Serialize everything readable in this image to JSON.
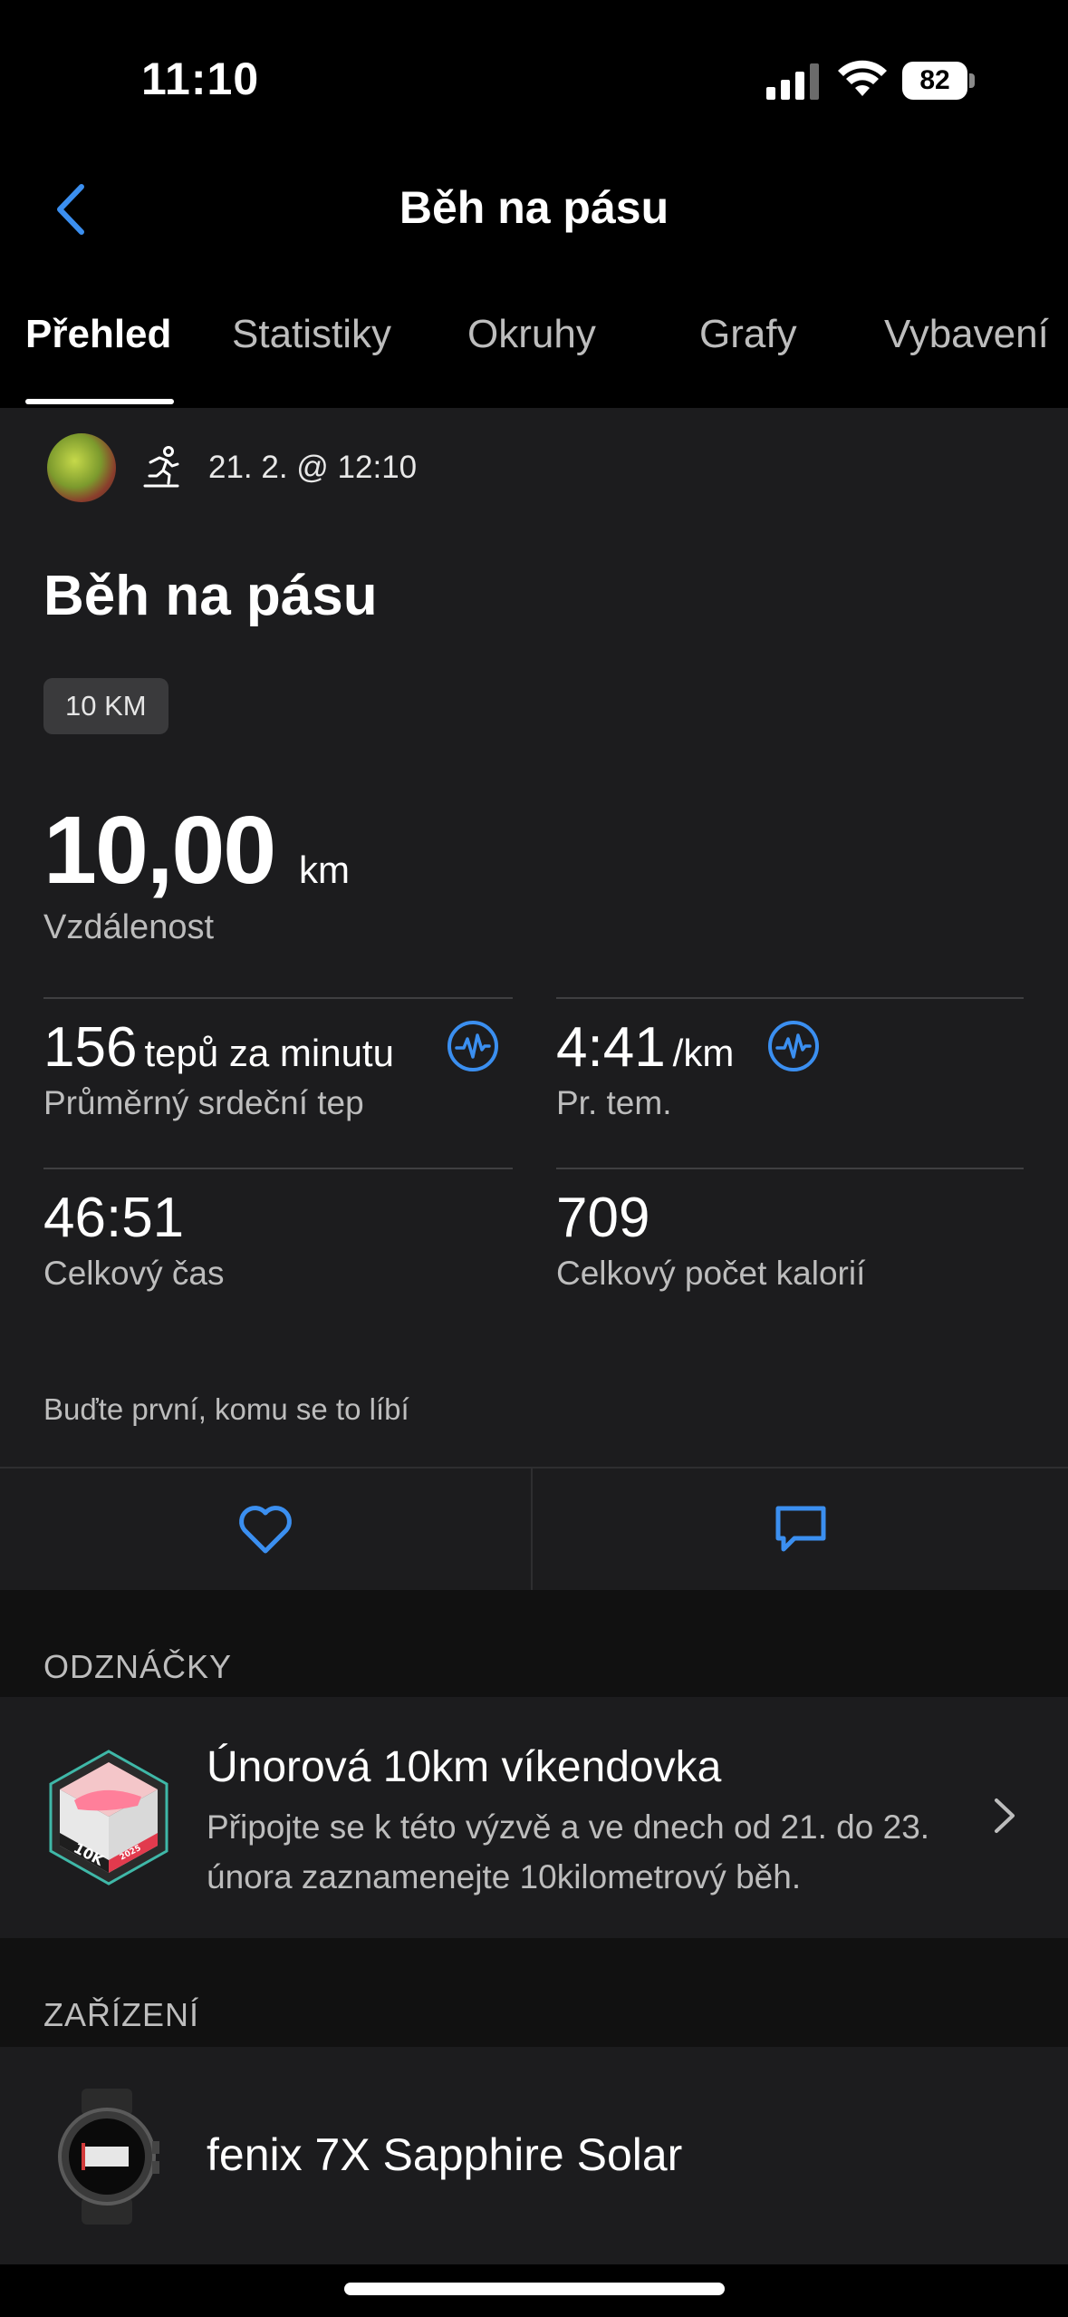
{
  "status_bar": {
    "time": "11:10",
    "battery": "82"
  },
  "header": {
    "title": "Běh na pásu"
  },
  "tabs": [
    {
      "label": "Přehled",
      "active": true
    },
    {
      "label": "Statistiky"
    },
    {
      "label": "Okruhy"
    },
    {
      "label": "Grafy"
    },
    {
      "label": "Vybavení"
    }
  ],
  "activity": {
    "date": "21. 2. @ 12:10",
    "title": "Běh na pásu",
    "badge": "10 KM",
    "distance": {
      "value": "10,00",
      "unit": "km",
      "label": "Vzdálenost"
    }
  },
  "stats": {
    "heart_rate": {
      "value": "156",
      "unit": "tepů za minutu",
      "label": "Průměrný srdeční tep"
    },
    "pace": {
      "value": "4:41",
      "unit": "/km",
      "label": "Pr. tem."
    },
    "time": {
      "value": "46:51",
      "label": "Celkový čas"
    },
    "calories": {
      "value": "709",
      "label": "Celkový počet kalorií"
    }
  },
  "social": {
    "likes_text": "Buďte první, komu se to líbí"
  },
  "badges_section": {
    "header": "ODZNÁČKY",
    "item": {
      "title": "Únorová 10km víkendovka",
      "description": "Připojte se k této výzvě a ve dnech od 21. do 23. února zaznamenejte 10kilometrový běh.",
      "image_text": "10K",
      "image_year": "2025"
    }
  },
  "devices_section": {
    "header": "ZAŘÍZENÍ",
    "device_name": "fenix 7X Sapphire Solar"
  },
  "colors": {
    "accent": "#3b8ff0",
    "card": "#1c1c1e",
    "section_bg": "#111111"
  }
}
